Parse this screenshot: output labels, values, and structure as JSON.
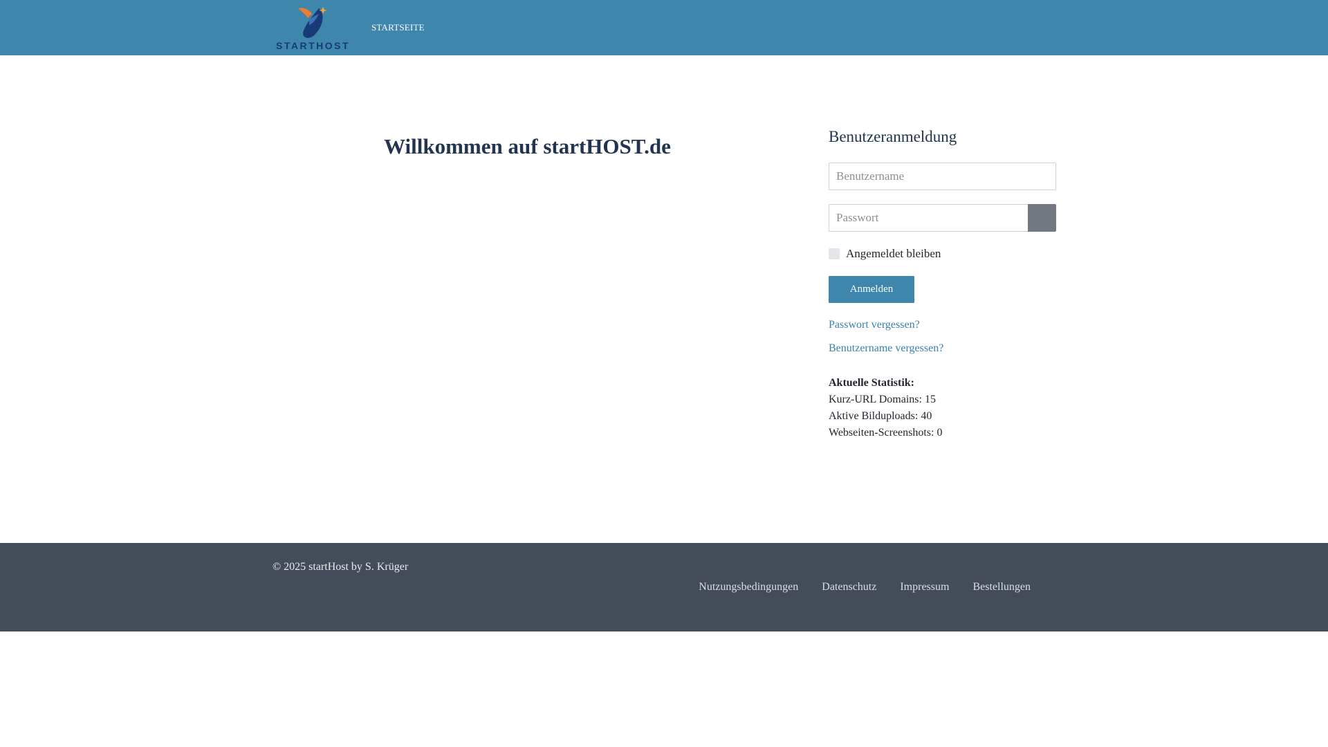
{
  "header": {
    "logo_text": "STARTHOST",
    "nav": {
      "start_label": "STARTSEITE"
    }
  },
  "main": {
    "welcome_title": "Willkommen auf startHOST.de"
  },
  "login": {
    "title": "Benutzeranmeldung",
    "username": {
      "placeholder": "Benutzername",
      "value": ""
    },
    "password": {
      "placeholder": "Passwort",
      "value": ""
    },
    "remember_label": "Angemeldet bleiben",
    "remember_checked": false,
    "submit_label": "Anmelden",
    "forgot_password": "Passwort vergessen?",
    "forgot_username": "Benutzername vergessen?"
  },
  "stats": {
    "title": "Aktuelle Statistik:",
    "items": [
      "Kurz-URL Domains: 15",
      "Aktive Bilduploads: 40",
      "Webseiten-Screenshots: 0"
    ]
  },
  "footer": {
    "copyright": "© 2025 startHost by S. Krüger",
    "links": [
      "Nutzungsbedingungen",
      "Datenschutz",
      "Impressum",
      "Bestellungen"
    ]
  },
  "colors": {
    "brand": "#3e86ab",
    "footer_bg": "#454c59",
    "link": "#3a80ad",
    "heading": "#22344f",
    "logo_orange": "#ef7d2f",
    "logo_navy": "#183a78"
  },
  "icons": {
    "logo": "rocket-logo-icon",
    "password_toggle": "eye-icon"
  }
}
